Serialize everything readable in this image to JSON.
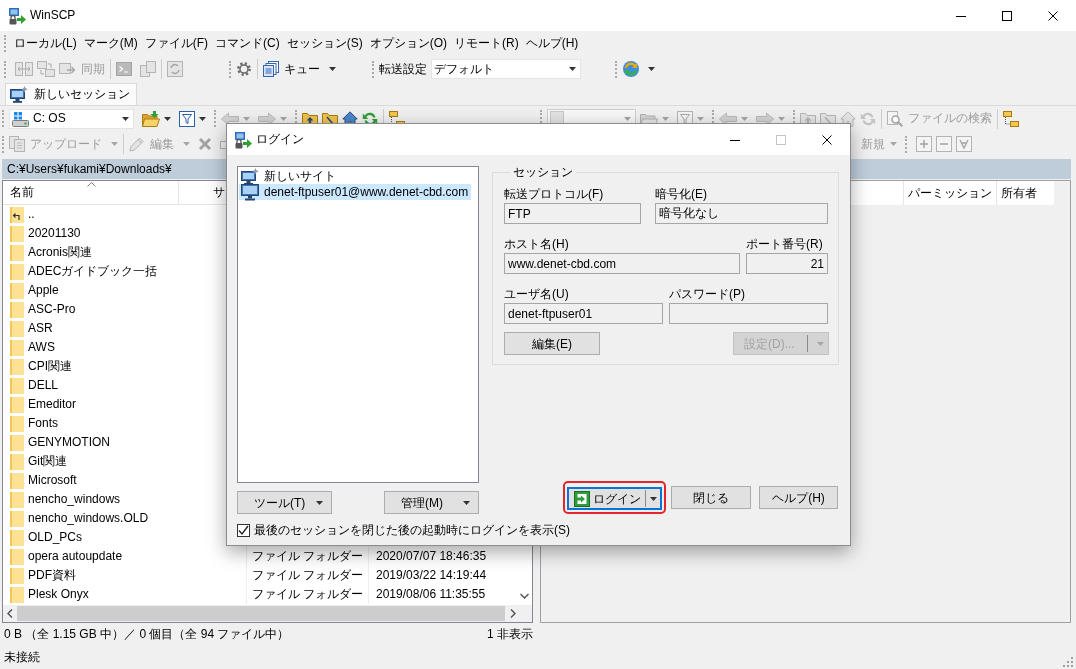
{
  "window": {
    "title": "WinSCP"
  },
  "menu": [
    "ローカル(L)",
    "マーク(M)",
    "ファイル(F)",
    "コマンド(C)",
    "セッション(S)",
    "オプション(O)",
    "リモート(R)",
    "ヘルプ(H)"
  ],
  "toolbar": {
    "sync": {
      "label": "同期",
      "disabled": true
    },
    "queue": {
      "label": "キュー"
    },
    "transfer_settings": {
      "label": "転送設定",
      "value": "デフォルト"
    }
  },
  "session_tabs": [
    {
      "label": "新しいセッション",
      "selected": true
    }
  ],
  "local_panel": {
    "drive": "C: OS",
    "actions": [
      {
        "label": "アップロード",
        "disabled": true
      },
      {
        "label": "編集",
        "disabled": true
      }
    ],
    "path": "C:¥Users¥fukami¥Downloads¥",
    "columns": [
      "名前",
      "サ"
    ],
    "rows": [
      {
        "name": "..",
        "kind": "parent"
      },
      {
        "name": "20201130",
        "kind": "folder"
      },
      {
        "name": "Acronis関連",
        "kind": "folder"
      },
      {
        "name": "ADECガイドブック一括",
        "kind": "folder"
      },
      {
        "name": "Apple",
        "kind": "folder"
      },
      {
        "name": "ASC-Pro",
        "kind": "folder"
      },
      {
        "name": "ASR",
        "kind": "folder"
      },
      {
        "name": "AWS",
        "kind": "folder"
      },
      {
        "name": "CPI関連",
        "kind": "folder"
      },
      {
        "name": "DELL",
        "kind": "folder"
      },
      {
        "name": "Emeditor",
        "kind": "folder"
      },
      {
        "name": "Fonts",
        "kind": "folder"
      },
      {
        "name": "GENYMOTION",
        "kind": "folder"
      },
      {
        "name": "Git関連",
        "kind": "folder"
      },
      {
        "name": "Microsoft",
        "kind": "folder"
      },
      {
        "name": "nencho_windows",
        "kind": "folder"
      },
      {
        "name": "nencho_windows.OLD",
        "kind": "folder"
      },
      {
        "name": "OLD_PCs",
        "kind": "folder"
      },
      {
        "name": "opera autoupdate",
        "kind": "folder",
        "type": "ファイル フォルダー",
        "modified": "2020/07/07 18:46:35"
      },
      {
        "name": "PDF資料",
        "kind": "folder",
        "type": "ファイル フォルダー",
        "modified": "2019/03/22 14:19:44"
      },
      {
        "name": "Plesk Onyx",
        "kind": "folder",
        "type": "ファイル フォルダー",
        "modified": "2019/08/06 11:35:55"
      }
    ],
    "status": "0 B （全 1.15 GB 中）／ 0 個目（全 94 ファイル中）",
    "hidden_files": "1 非表示"
  },
  "remote_panel": {
    "find": {
      "label": "ファイルの検索",
      "disabled": true
    },
    "new": {
      "label": "新規",
      "disabled": true
    },
    "columns": [
      "パーミッション",
      "所有者"
    ]
  },
  "status_bar": "未接続",
  "login_dialog": {
    "title": "ログイン",
    "sites": [
      {
        "label": "新しいサイト",
        "kind": "new",
        "selected": false
      },
      {
        "label": "denet-ftpuser01@www.denet-cbd.com",
        "kind": "site",
        "selected": true
      }
    ],
    "site_buttons": [
      "ツール(T)",
      "管理(M)"
    ],
    "show_login_on_startup": {
      "label": "最後のセッションを閉じた後の起動時にログインを表示(S)",
      "checked": true
    },
    "session": {
      "legend": "セッション",
      "field_rows": [
        [
          {
            "label": "転送プロトコル(F)",
            "value": "FTP",
            "kind": "text"
          },
          {
            "label": "暗号化(E)",
            "value": "暗号化なし",
            "kind": "text"
          }
        ],
        [
          {
            "label": "ホスト名(H)",
            "value": "www.denet-cbd.com",
            "kind": "text"
          },
          {
            "label": "ポート番号(R)",
            "value": "21",
            "kind": "number"
          }
        ],
        [
          {
            "label": "ユーザ名(U)",
            "value": "denet-ftpuser01",
            "kind": "text"
          },
          {
            "label": "パスワード(P)",
            "kind": "password"
          }
        ]
      ],
      "edit_button": "編集(E)",
      "advanced_button": {
        "label": "設定(D)...",
        "disabled": true
      }
    },
    "buttons": [
      {
        "label": "ログイン",
        "kind": "login",
        "focused": true,
        "highlighted": true
      },
      {
        "label": "閉じる",
        "kind": "plain",
        "focused": false,
        "highlighted": false
      },
      {
        "label": "ヘルプ(H)",
        "kind": "plain",
        "focused": false,
        "highlighted": false
      }
    ]
  }
}
